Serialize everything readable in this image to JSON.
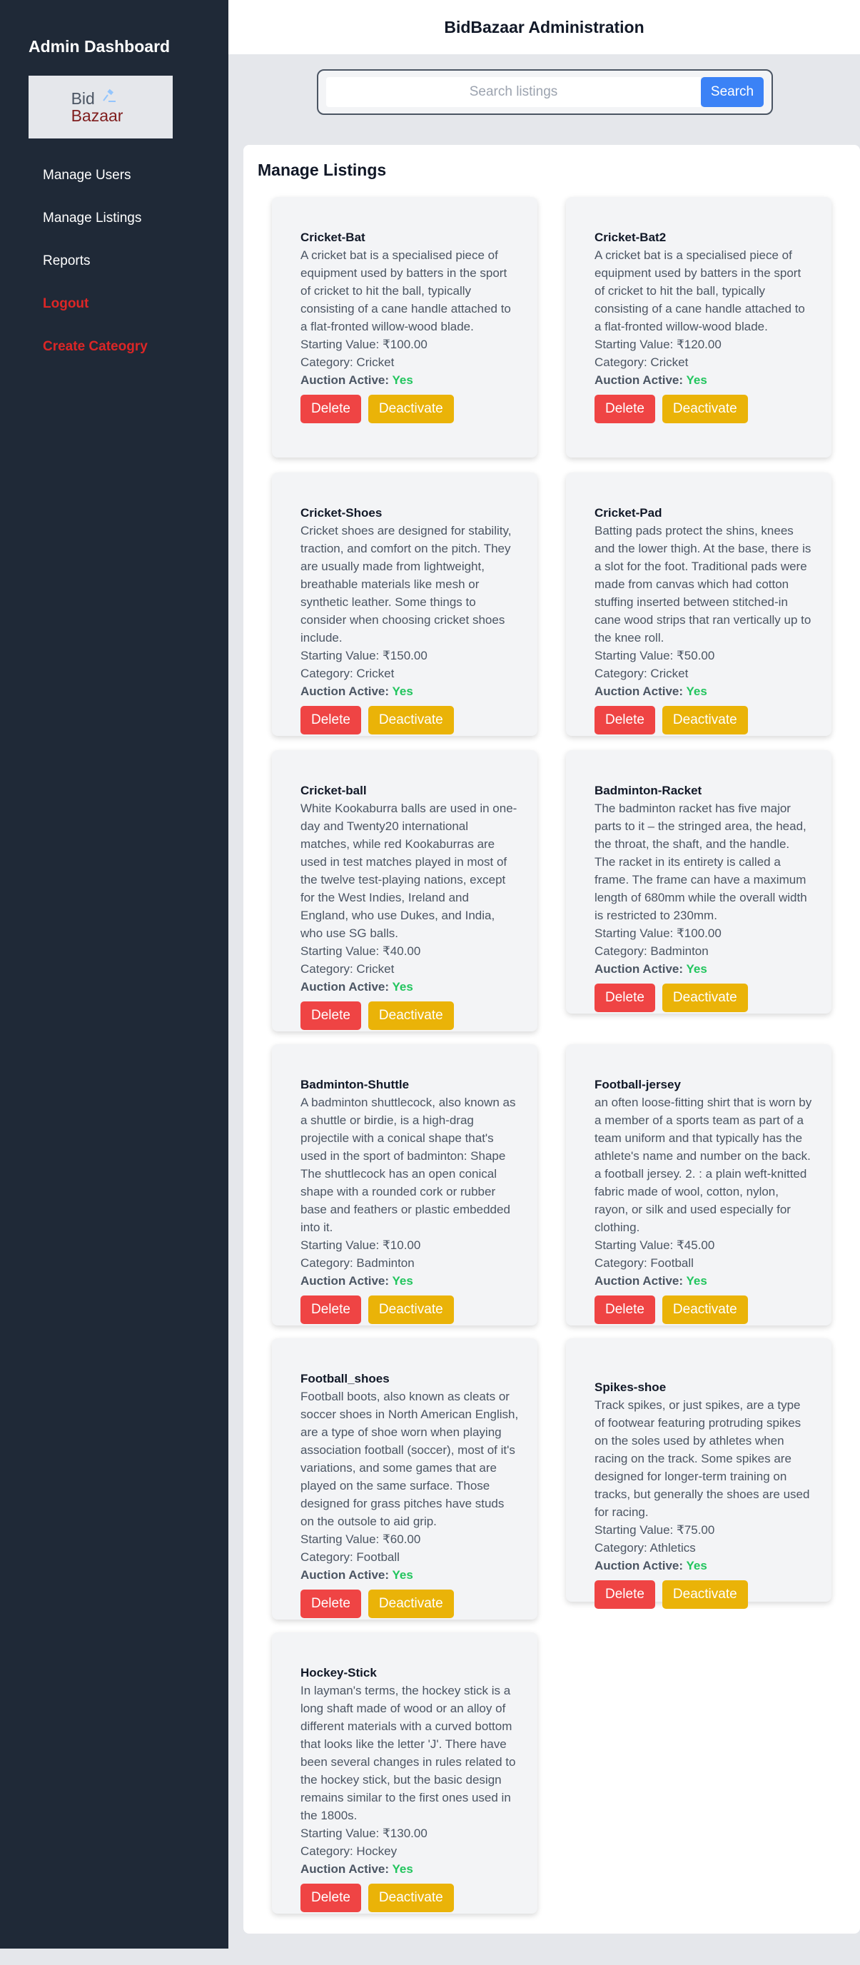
{
  "sidebar": {
    "title": "Admin Dashboard",
    "logo_top": "Bid",
    "logo_bottom": "Bazaar",
    "items": [
      {
        "label": "Manage Users"
      },
      {
        "label": "Manage Listings"
      },
      {
        "label": "Reports"
      },
      {
        "label": "Logout"
      },
      {
        "label": "Create Cateogry"
      }
    ]
  },
  "header": {
    "title": "BidBazaar Administration"
  },
  "search": {
    "placeholder": "Search listings",
    "value": "",
    "button_label": "Search"
  },
  "main": {
    "title": "Manage Listings",
    "delete_label": "Delete",
    "deactivate_label": "Deactivate",
    "active_label": "Auction Active:",
    "listings": [
      {
        "name": "Cricket-Bat",
        "description": "A cricket bat is a specialised piece of equipment used by batters in the sport of cricket to hit the ball, typically consisting of a cane handle attached to a flat-fronted willow-wood blade.",
        "starting_value": "Starting Value: ₹100.00",
        "category": "Category: Cricket",
        "active": "Yes"
      },
      {
        "name": "Cricket-Bat2",
        "description": "A cricket bat is a specialised piece of equipment used by batters in the sport of cricket to hit the ball, typically consisting of a cane handle attached to a flat-fronted willow-wood blade.",
        "starting_value": "Starting Value: ₹120.00",
        "category": "Category: Cricket",
        "active": "Yes"
      },
      {
        "name": "Cricket-Shoes",
        "description": "Cricket shoes are designed for stability, traction, and comfort on the pitch. They are usually made from lightweight, breathable materials like mesh or synthetic leather. Some things to consider when choosing cricket shoes include.",
        "starting_value": "Starting Value: ₹150.00",
        "category": "Category: Cricket",
        "active": "Yes"
      },
      {
        "name": "Cricket-Pad",
        "description": "Batting pads protect the shins, knees and the lower thigh. At the base, there is a slot for the foot. Traditional pads were made from canvas which had cotton stuffing inserted between stitched-in cane wood strips that ran vertically up to the knee roll.",
        "starting_value": "Starting Value: ₹50.00",
        "category": "Category: Cricket",
        "active": "Yes"
      },
      {
        "name": "Cricket-ball",
        "description": "White Kookaburra balls are used in one-day and Twenty20 international matches, while red Kookaburras are used in test matches played in most of the twelve test-playing nations, except for the West Indies, Ireland and England, who use Dukes, and India, who use SG balls.",
        "starting_value": "Starting Value: ₹40.00",
        "category": "Category: Cricket",
        "active": "Yes"
      },
      {
        "name": "Badminton-Racket",
        "description": "The badminton racket has five major parts to it – the stringed area, the head, the throat, the shaft, and the handle. The racket in its entirety is called a frame. The frame can have a maximum length of 680mm while the overall width is restricted to 230mm.",
        "starting_value": "Starting Value: ₹100.00",
        "category": "Category: Badminton",
        "active": "Yes"
      },
      {
        "name": "Badminton-Shuttle",
        "description": "A badminton shuttlecock, also known as a shuttle or birdie, is a high-drag projectile with a conical shape that's used in the sport of badminton: Shape The shuttlecock has an open conical shape with a rounded cork or rubber base and feathers or plastic embedded into it.",
        "starting_value": "Starting Value: ₹10.00",
        "category": "Category: Badminton",
        "active": "Yes"
      },
      {
        "name": "Football-jersey",
        "description": "an often loose-fitting shirt that is worn by a member of a sports team as part of a team uniform and that typically has the athlete's name and number on the back. a football jersey. 2. : a plain weft-knitted fabric made of wool, cotton, nylon, rayon, or silk and used especially for clothing.",
        "starting_value": "Starting Value: ₹45.00",
        "category": "Category: Football",
        "active": "Yes"
      },
      {
        "name": "Football_shoes",
        "description": "Football boots, also known as cleats or soccer shoes in North American English, are a type of shoe worn when playing association football (soccer), most of it's variations, and some games that are played on the same surface. Those designed for grass pitches have studs on the outsole to aid grip.",
        "starting_value": "Starting Value: ₹60.00",
        "category": "Category: Football",
        "active": "Yes"
      },
      {
        "name": "Spikes-shoe",
        "description": "Track spikes, or just spikes, are a type of footwear featuring protruding spikes on the soles used by athletes when racing on the track. Some spikes are designed for longer-term training on tracks, but generally the shoes are used for racing.",
        "starting_value": "Starting Value: ₹75.00",
        "category": "Category: Athletics",
        "active": "Yes"
      },
      {
        "name": "Hockey-Stick",
        "description": "In layman's terms, the hockey stick is a long shaft made of wood or an alloy of different materials with a curved bottom that looks like the letter 'J'. There have been several changes in rules related to the hockey stick, but the basic design remains similar to the first ones used in the 1800s.",
        "starting_value": "Starting Value: ₹130.00",
        "category": "Category: Hockey",
        "active": "Yes"
      }
    ]
  }
}
